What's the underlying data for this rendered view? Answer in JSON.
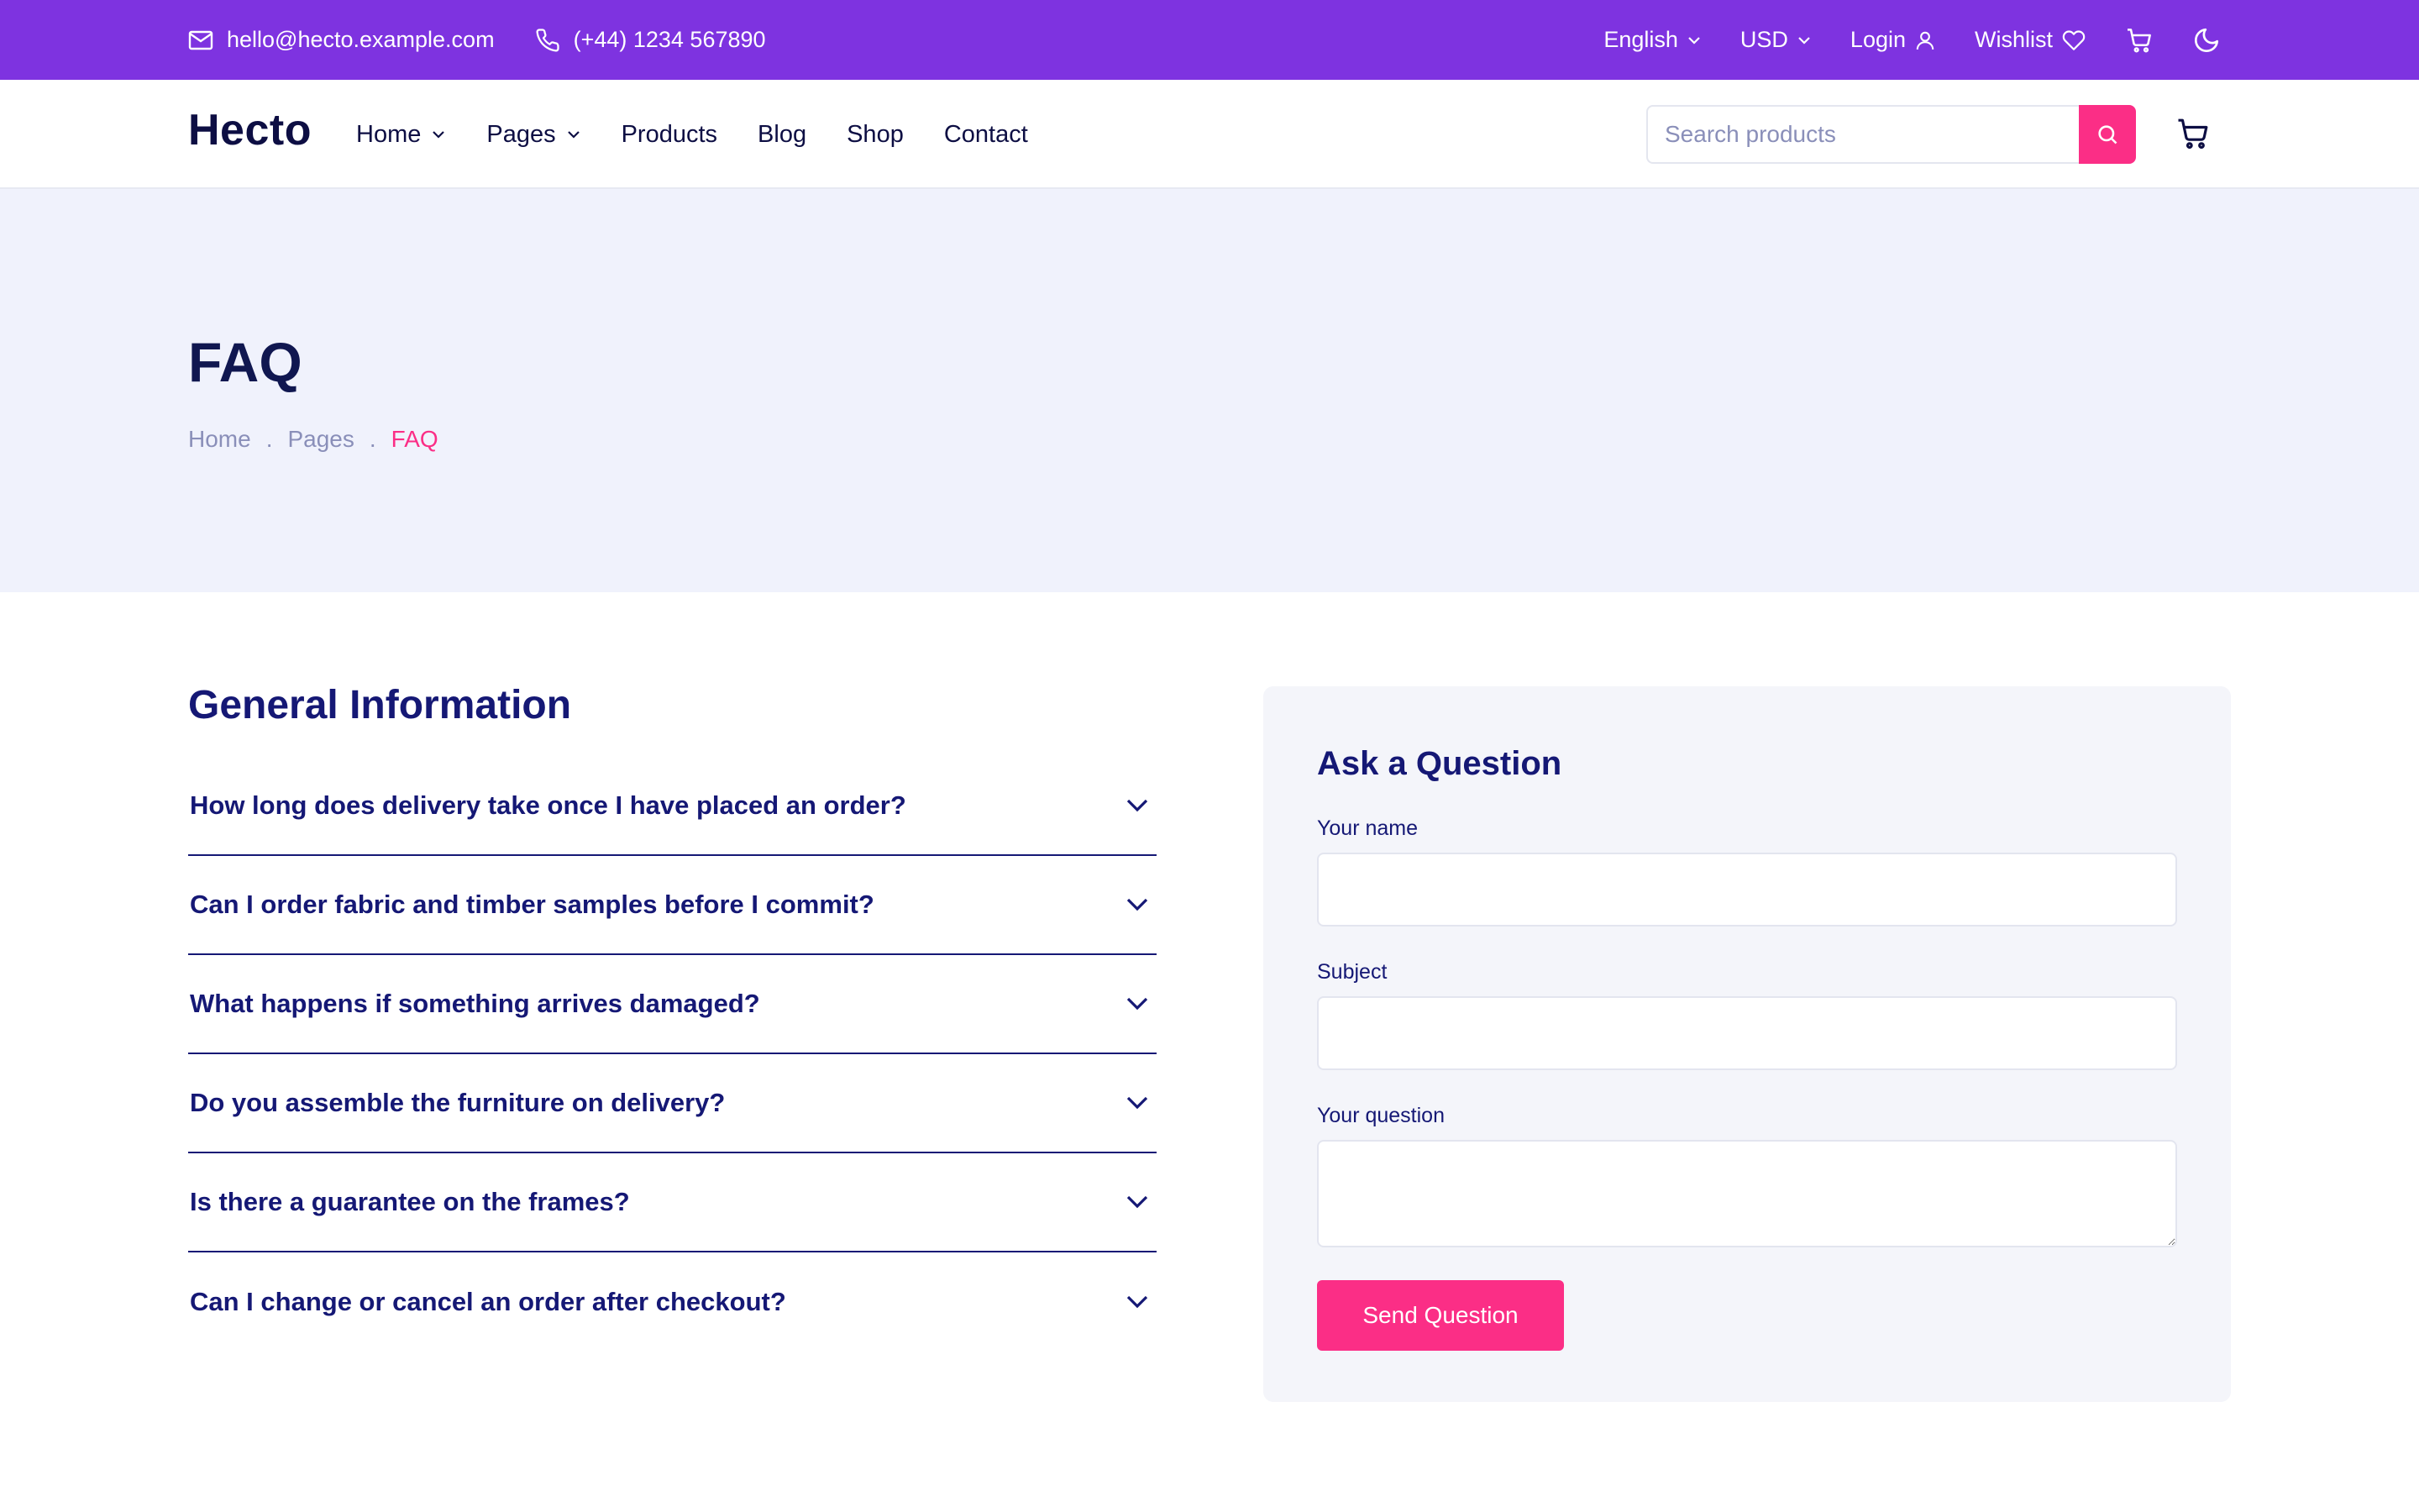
{
  "topbar": {
    "email": "hello@hecto.example.com",
    "phone": "(+44) 1234 567890",
    "language": "English",
    "currency": "USD",
    "login": "Login",
    "wishlist": "Wishlist",
    "bg_color": "#7e33e0"
  },
  "header": {
    "logo": "Hecto",
    "nav": {
      "home": "Home",
      "pages": "Pages",
      "products": "Products",
      "blog": "Blog",
      "shop": "Shop",
      "contact": "Contact"
    },
    "search_placeholder": "Search products",
    "accent_color": "#fb2e86"
  },
  "hero": {
    "title": "FAQ",
    "breadcrumb": {
      "home": "Home",
      "pages": "Pages",
      "current": "FAQ",
      "separator": "."
    }
  },
  "faq": {
    "title": "General Information",
    "items": [
      "How long does delivery take once I have placed an order?",
      "Can I order fabric and timber samples before I commit?",
      "What happens if something arrives damaged?",
      "Do you assemble the furniture on delivery?",
      "Is there a guarantee on the frames?",
      "Can I change or cancel an order after checkout?"
    ]
  },
  "ask": {
    "title": "Ask a Question",
    "name_label": "Your name",
    "subject_label": "Subject",
    "question_label": "Your question",
    "send_label": "Send Question"
  }
}
